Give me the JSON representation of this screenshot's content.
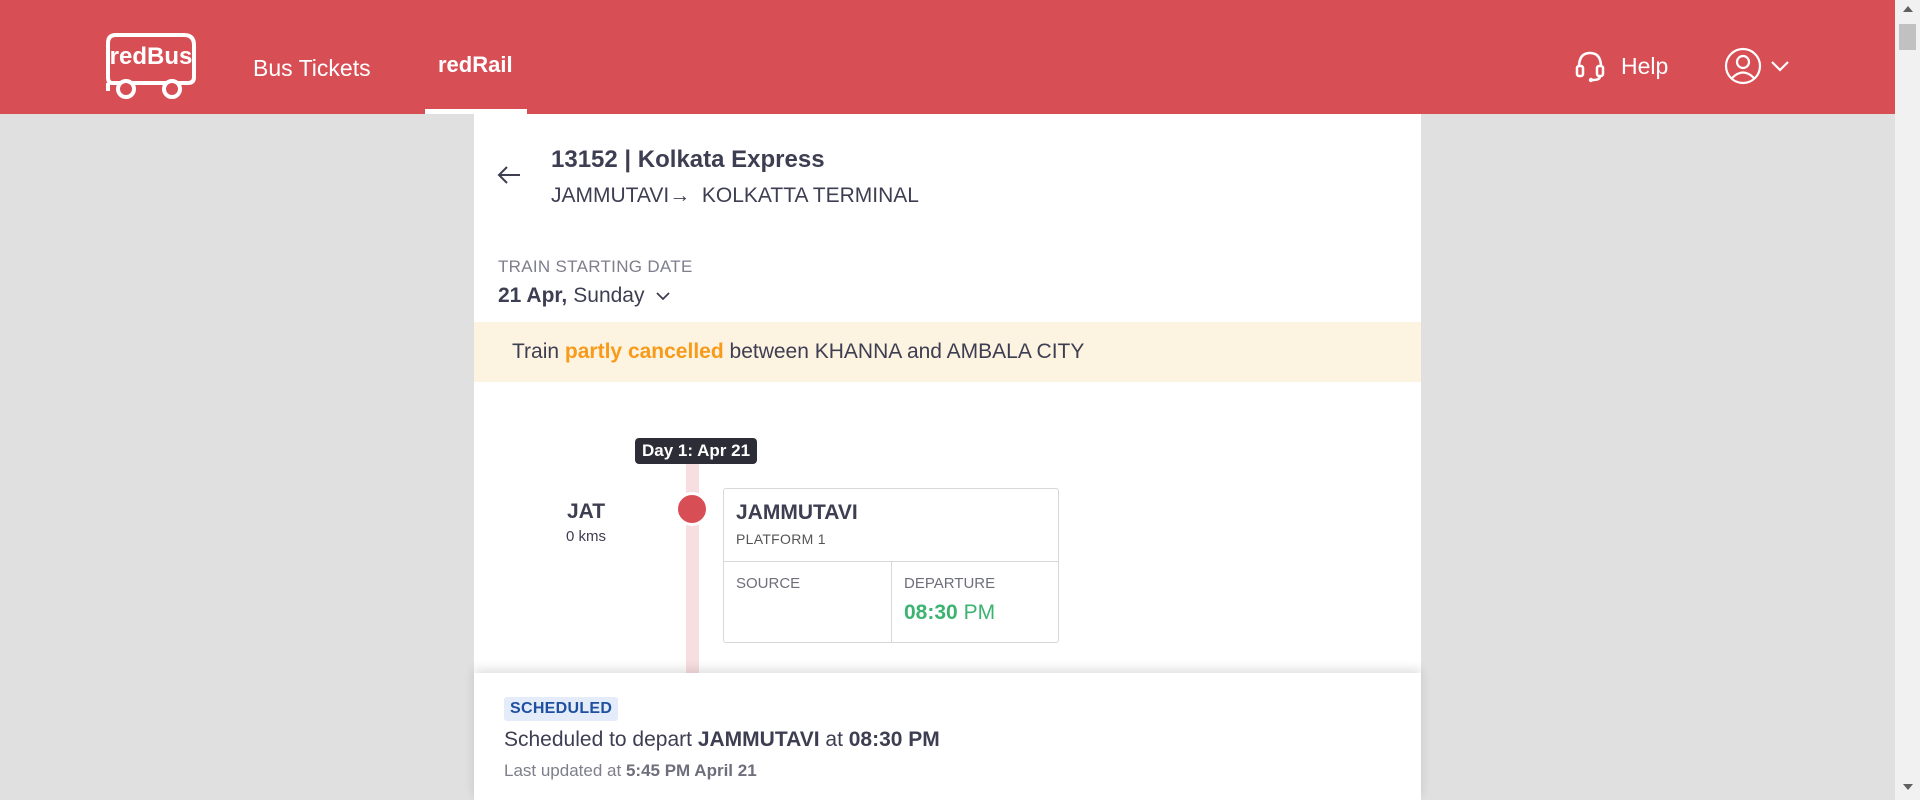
{
  "header": {
    "logo_text": "redBus",
    "nav": {
      "bus_tickets": "Bus Tickets",
      "red_rail": "redRail"
    },
    "help_label": "Help",
    "colors": {
      "brand": "#d84e55"
    }
  },
  "train": {
    "title": "13152 | Kolkata Express",
    "from": "JAMMUTAVI",
    "arrow": "→",
    "to": "KOLKATTA TERMINAL",
    "start_date_label": "TRAIN STARTING DATE",
    "start_date_bold": "21 Apr,",
    "start_day": "Sunday"
  },
  "alert": {
    "prefix": "Train",
    "highlight": "partly cancelled",
    "suffix": "between KHANNA and AMBALA CITY"
  },
  "timeline": {
    "day_badge": "Day 1: Apr 21",
    "station": {
      "code": "JAT",
      "distance": "0 kms",
      "name": "JAMMUTAVI",
      "platform": "PLATFORM 1",
      "source_label": "SOURCE",
      "departure_label": "DEPARTURE",
      "departure_time": "08:30",
      "departure_ampm": "PM"
    }
  },
  "status": {
    "badge": "SCHEDULED",
    "msg_prefix": "Scheduled to depart",
    "msg_station": "JAMMUTAVI",
    "msg_at": "at",
    "msg_time": "08:30 PM",
    "updated_prefix": "Last updated at",
    "updated_time": "5:45 PM April 21"
  }
}
